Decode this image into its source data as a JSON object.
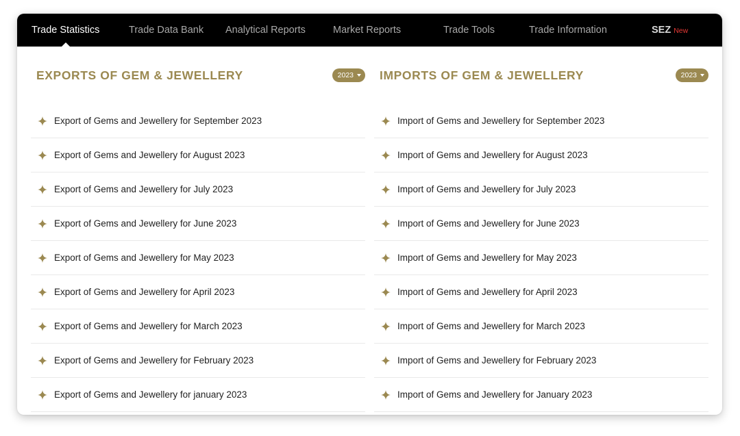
{
  "nav": {
    "items": [
      {
        "label": "Trade Statistics",
        "active": true
      },
      {
        "label": "Trade Data Bank",
        "active": false
      },
      {
        "label": "Analytical Reports",
        "active": false
      },
      {
        "label": "Market Reports",
        "active": false
      },
      {
        "label": "Trade Tools",
        "active": false
      },
      {
        "label": "Trade Information",
        "active": false
      }
    ],
    "sez": {
      "label": "SEZ",
      "badge": "New"
    }
  },
  "exports": {
    "title": "EXPORTS OF GEM & JEWELLERY",
    "year": "2023",
    "items": [
      "Export of Gems and Jewellery for September 2023",
      "Export of Gems and Jewellery for August 2023",
      "Export of Gems and Jewellery for July 2023",
      "Export of Gems and Jewellery for June 2023",
      "Export of Gems and Jewellery for May 2023",
      "Export of Gems and Jewellery for April 2023",
      "Export of Gems and Jewellery for March 2023",
      "Export of Gems and Jewellery for February 2023",
      "Export of Gems and Jewellery for january 2023"
    ]
  },
  "imports": {
    "title": "IMPORTS OF GEM & JEWELLERY",
    "year": "2023",
    "items": [
      "Import of Gems and Jewellery for September 2023",
      "Import of Gems and Jewellery for August 2023",
      "Import of Gems and Jewellery for July 2023",
      "Import of Gems and Jewellery for June 2023",
      "Import of Gems and Jewellery for May 2023",
      "Import of Gems and Jewellery for April 2023",
      "Import of Gems and Jewellery for March 2023",
      "Import of Gems and Jewellery for February 2023",
      "Import of Gems and Jewellery for January 2023"
    ]
  },
  "colors": {
    "accent": "#9b8951",
    "nav_bg": "#000000",
    "badge_new": "#e53935"
  },
  "icons": {
    "bullet": "sparkle-star-icon",
    "dropdown": "caret-down-icon"
  }
}
